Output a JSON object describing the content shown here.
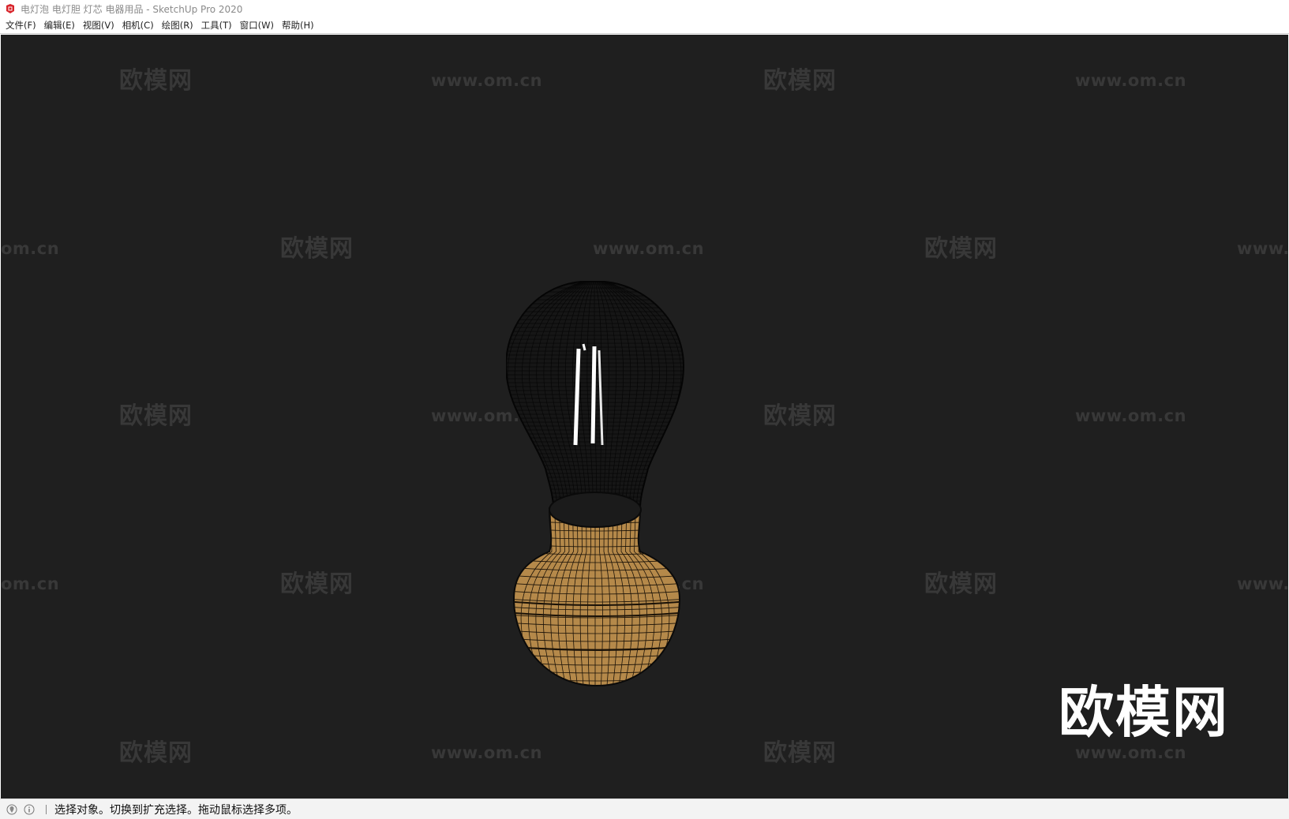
{
  "window": {
    "title": "电灯泡 电灯胆 灯芯 电器用品 - SketchUp Pro 2020",
    "icon": "sketchup-app-icon"
  },
  "menu": [
    {
      "label": "文件(F)"
    },
    {
      "label": "编辑(E)"
    },
    {
      "label": "视图(V)"
    },
    {
      "label": "相机(C)"
    },
    {
      "label": "绘图(R)"
    },
    {
      "label": "工具(T)"
    },
    {
      "label": "窗口(W)"
    },
    {
      "label": "帮助(H)"
    }
  ],
  "viewport": {
    "background": "#1f1f1f",
    "model_colors": {
      "base": "#b5894a",
      "wire": "#0a0a0a",
      "filament": "#ffffff"
    },
    "watermark_cn": "欧模网",
    "watermark_url": "www.om.cn",
    "watermark_url_partial_left": "om.cn",
    "watermark_url_partial_right": "www.",
    "watermark_big": "欧模网"
  },
  "statusbar": {
    "icons": [
      "geo-location-icon",
      "info-icon"
    ],
    "message": "选择对象。切换到扩充选择。拖动鼠标选择多项。"
  }
}
